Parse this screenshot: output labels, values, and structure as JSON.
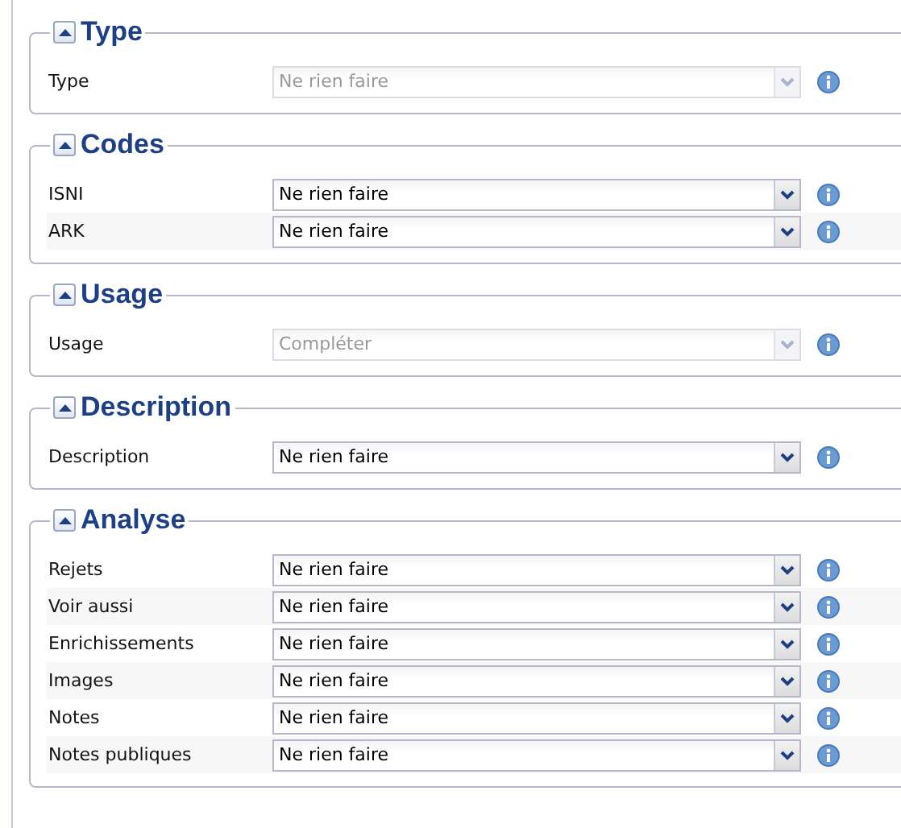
{
  "sections": [
    {
      "title": "Type",
      "expanded": true,
      "fields": [
        {
          "label": "Type",
          "value": "Ne rien faire",
          "disabled": true
        }
      ]
    },
    {
      "title": "Codes",
      "expanded": true,
      "fields": [
        {
          "label": "ISNI",
          "value": "Ne rien faire",
          "disabled": false
        },
        {
          "label": "ARK",
          "value": "Ne rien faire",
          "disabled": false
        }
      ]
    },
    {
      "title": "Usage",
      "expanded": true,
      "fields": [
        {
          "label": "Usage",
          "value": "Compléter",
          "disabled": true
        }
      ]
    },
    {
      "title": "Description",
      "expanded": true,
      "fields": [
        {
          "label": "Description",
          "value": "Ne rien faire",
          "disabled": false
        }
      ]
    },
    {
      "title": "Analyse",
      "expanded": true,
      "fields": [
        {
          "label": "Rejets",
          "value": "Ne rien faire",
          "disabled": false
        },
        {
          "label": "Voir aussi",
          "value": "Ne rien faire",
          "disabled": false
        },
        {
          "label": "Enrichissements",
          "value": "Ne rien faire",
          "disabled": false
        },
        {
          "label": "Images",
          "value": "Ne rien faire",
          "disabled": false
        },
        {
          "label": "Notes",
          "value": "Ne rien faire",
          "disabled": false
        },
        {
          "label": "Notes publiques",
          "value": "Ne rien faire",
          "disabled": false
        }
      ]
    }
  ]
}
